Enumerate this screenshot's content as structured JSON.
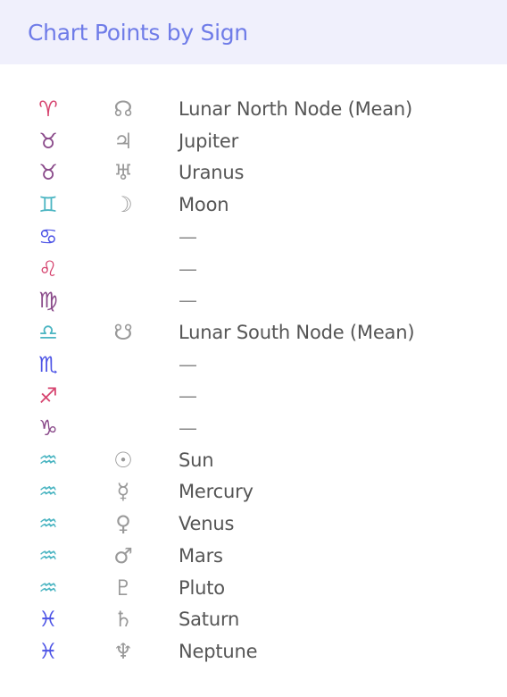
{
  "header": {
    "title": "Chart Points by Sign"
  },
  "colors": {
    "fire": "#d6446f",
    "earth": "#8a4a8a",
    "air": "#4bb5c2",
    "water": "#4e55e6",
    "planet_glyph": "#999999",
    "text": "#555555"
  },
  "rows": [
    {
      "sign": "aries",
      "sign_glyph": "♈",
      "element": "fire",
      "planet_icon": "north-node-icon",
      "planet_glyph": "☊",
      "name": "Lunar North Node (Mean)"
    },
    {
      "sign": "taurus",
      "sign_glyph": "♉",
      "element": "earth",
      "planet_icon": "jupiter-icon",
      "planet_glyph": "♃",
      "name": "Jupiter"
    },
    {
      "sign": "taurus",
      "sign_glyph": "♉",
      "element": "earth",
      "planet_icon": "uranus-icon",
      "planet_glyph": "♅",
      "name": "Uranus"
    },
    {
      "sign": "gemini",
      "sign_glyph": "♊",
      "element": "air",
      "planet_icon": "moon-icon",
      "planet_glyph": "☽",
      "name": "Moon"
    },
    {
      "sign": "cancer",
      "sign_glyph": "♋",
      "element": "water",
      "planet_icon": "",
      "planet_glyph": "",
      "name": "—"
    },
    {
      "sign": "leo",
      "sign_glyph": "♌",
      "element": "fire",
      "planet_icon": "",
      "planet_glyph": "",
      "name": "—"
    },
    {
      "sign": "virgo",
      "sign_glyph": "♍",
      "element": "earth",
      "planet_icon": "",
      "planet_glyph": "",
      "name": "—"
    },
    {
      "sign": "libra",
      "sign_glyph": "♎",
      "element": "air",
      "planet_icon": "south-node-icon",
      "planet_glyph": "☋",
      "name": "Lunar South Node (Mean)"
    },
    {
      "sign": "scorpio",
      "sign_glyph": "♏",
      "element": "water",
      "planet_icon": "",
      "planet_glyph": "",
      "name": "—"
    },
    {
      "sign": "sagittarius",
      "sign_glyph": "♐",
      "element": "fire",
      "planet_icon": "",
      "planet_glyph": "",
      "name": "—"
    },
    {
      "sign": "capricorn",
      "sign_glyph": "♑",
      "element": "earth",
      "planet_icon": "",
      "planet_glyph": "",
      "name": "—"
    },
    {
      "sign": "aquarius",
      "sign_glyph": "♒",
      "element": "air",
      "planet_icon": "sun-icon",
      "planet_glyph": "☉",
      "name": "Sun"
    },
    {
      "sign": "aquarius",
      "sign_glyph": "♒",
      "element": "air",
      "planet_icon": "mercury-icon",
      "planet_glyph": "☿",
      "name": "Mercury"
    },
    {
      "sign": "aquarius",
      "sign_glyph": "♒",
      "element": "air",
      "planet_icon": "venus-icon",
      "planet_glyph": "♀",
      "name": "Venus"
    },
    {
      "sign": "aquarius",
      "sign_glyph": "♒",
      "element": "air",
      "planet_icon": "mars-icon",
      "planet_glyph": "♂",
      "name": "Mars"
    },
    {
      "sign": "aquarius",
      "sign_glyph": "♒",
      "element": "air",
      "planet_icon": "pluto-icon",
      "planet_glyph": "♇",
      "name": "Pluto"
    },
    {
      "sign": "pisces",
      "sign_glyph": "♓",
      "element": "water",
      "planet_icon": "saturn-icon",
      "planet_glyph": "♄",
      "name": "Saturn"
    },
    {
      "sign": "pisces",
      "sign_glyph": "♓",
      "element": "water",
      "planet_icon": "neptune-icon",
      "planet_glyph": "♆",
      "name": "Neptune"
    }
  ]
}
